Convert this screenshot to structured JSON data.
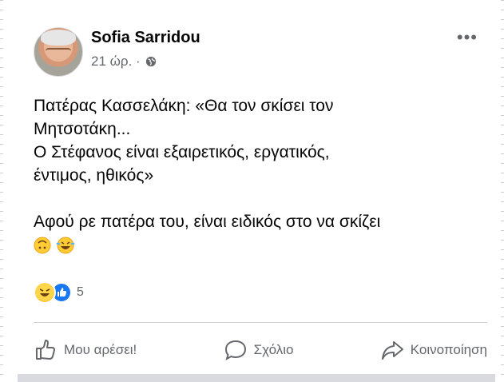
{
  "post": {
    "author": "Sofia Sarridou",
    "time": "21 ώρ. ·",
    "privacy_icon": "globe-icon",
    "lines": [
      "Πατέρας Κασσελάκη: «Θα τον σκίσει τον",
      "Μητσοτάκη...",
      "Ο Στέφανος είναι εξαιρετικός, εργατικός,",
      "έντιμος, ηθικός»",
      "Αφού ρε πατέρα του, είναι ειδικός στο να σκίζει"
    ],
    "trailing_emojis": [
      "upside-down-face-emoji",
      "laughing-emoji"
    ]
  },
  "reactions": {
    "icons": [
      "haha-reaction-icon",
      "like-reaction-icon"
    ],
    "count": "5"
  },
  "actions": {
    "like": "Μου αρέσει!",
    "comment": "Σχόλιο",
    "share": "Κοινοποίηση"
  },
  "colors": {
    "secondary_text": "#65676b",
    "like_blue": "#1877f2",
    "divider": "#ced0d4"
  }
}
